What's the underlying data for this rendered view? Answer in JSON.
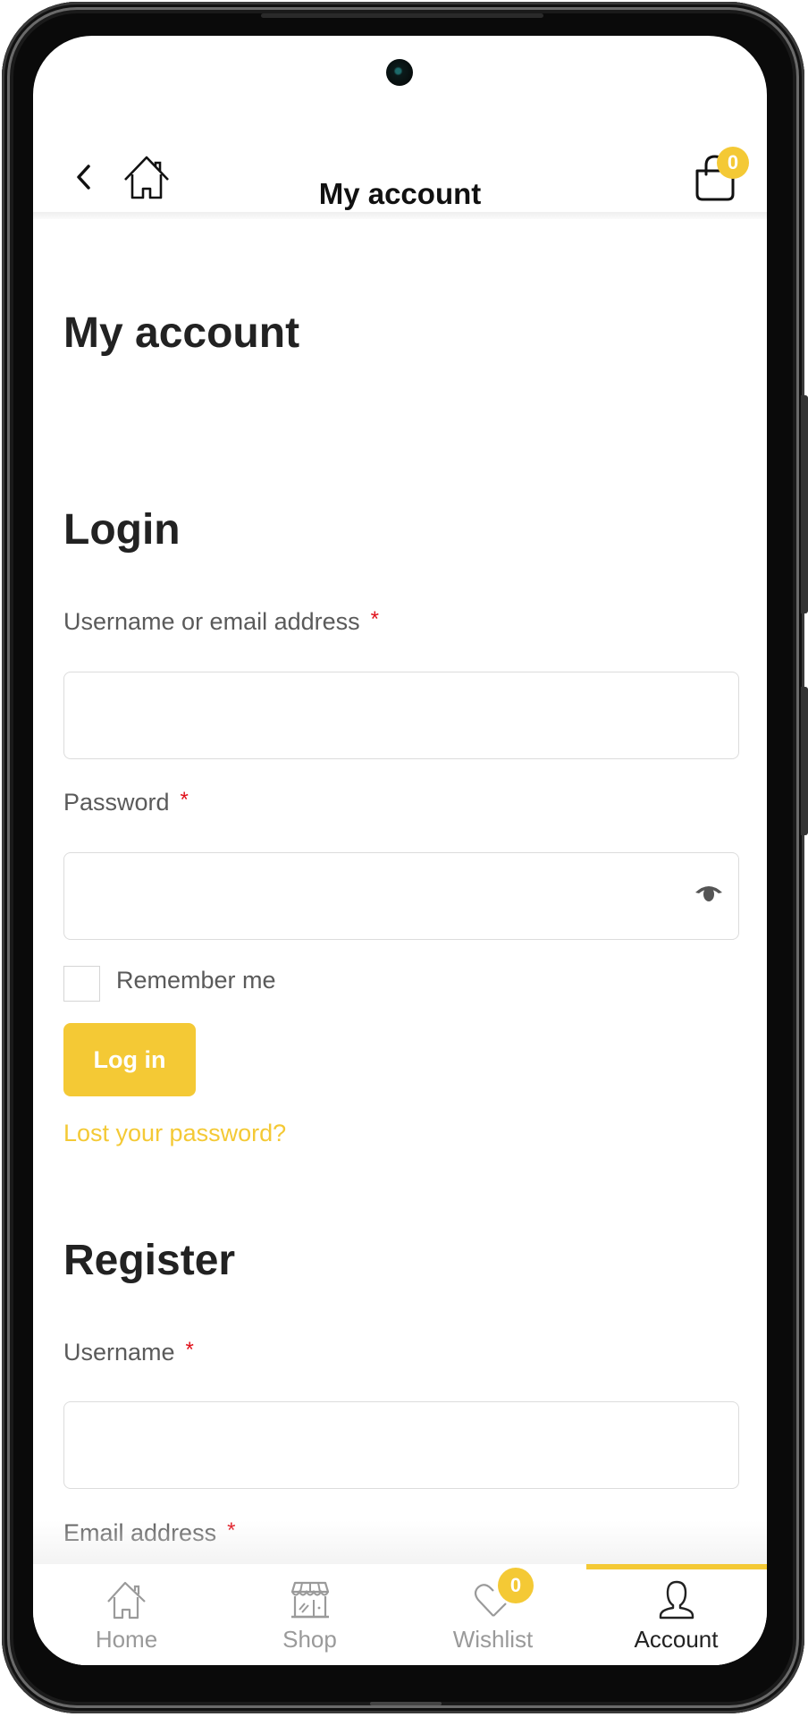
{
  "appbar": {
    "title": "My account",
    "cart_count": "0"
  },
  "page": {
    "heading": "My account"
  },
  "login": {
    "heading": "Login",
    "username_label": "Username or email address",
    "username_value": "",
    "password_label": "Password",
    "password_value": "",
    "required_mark": "*",
    "remember_label": "Remember me",
    "remember_checked": false,
    "submit_label": "Log in",
    "lost_password_link": "Lost your password?"
  },
  "register": {
    "heading": "Register",
    "username_label": "Username",
    "username_value": "",
    "email_label": "Email address",
    "email_value": "",
    "required_mark": "*"
  },
  "bottom_nav": {
    "items": [
      {
        "label": "Home",
        "icon": "home-icon",
        "active": false
      },
      {
        "label": "Shop",
        "icon": "shop-icon",
        "active": false
      },
      {
        "label": "Wishlist",
        "icon": "heart-icon",
        "active": false,
        "badge": "0"
      },
      {
        "label": "Account",
        "icon": "user-icon",
        "active": true
      }
    ]
  },
  "colors": {
    "accent": "#f4c935",
    "required": "#e0101a",
    "text": "#222222",
    "label": "#5a5a5a",
    "nav_inactive": "#9a9a9a"
  }
}
